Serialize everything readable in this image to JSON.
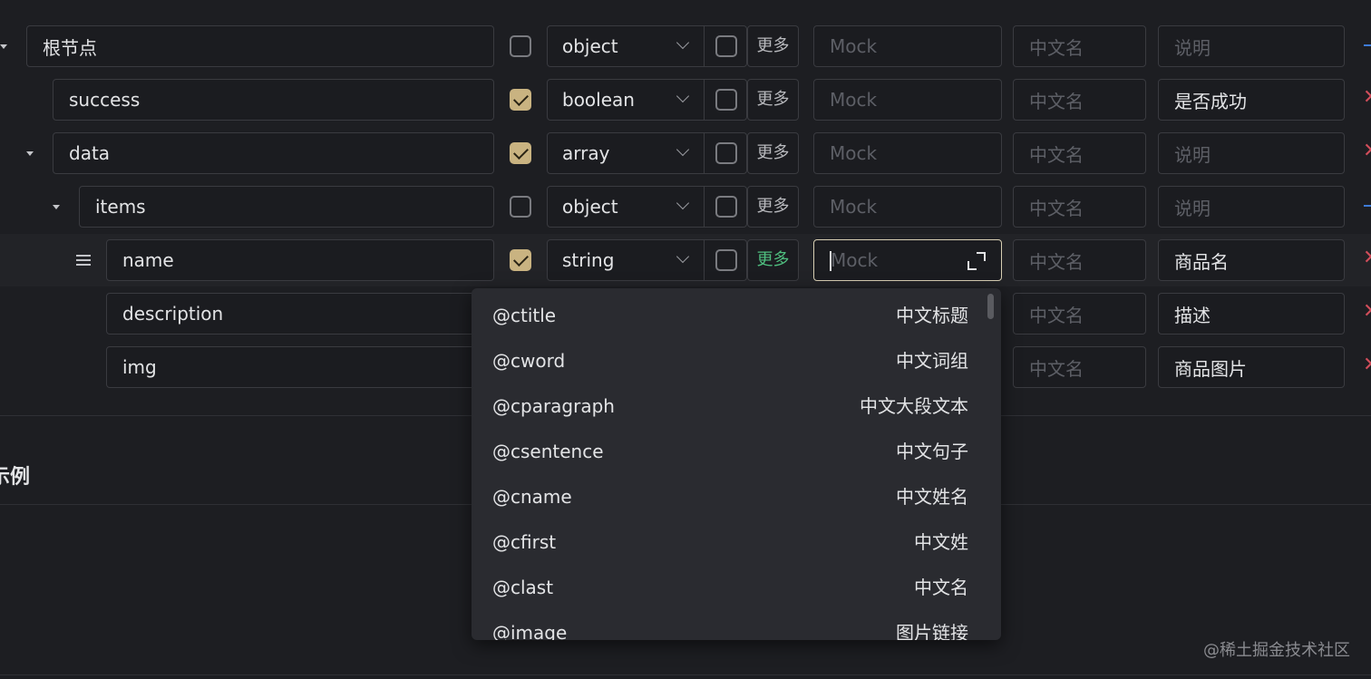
{
  "rows": [
    {
      "name": "根节点",
      "required": false,
      "type": "object",
      "mock_placeholder": "Mock",
      "cn_placeholder": "中文名",
      "desc": "说明",
      "desc_filled": false,
      "more": "更多",
      "action": "add"
    },
    {
      "name": "success",
      "required": true,
      "type": "boolean",
      "mock_placeholder": "Mock",
      "cn_placeholder": "中文名",
      "desc": "是否成功",
      "desc_filled": true,
      "more": "更多",
      "action": "remove"
    },
    {
      "name": "data",
      "required": true,
      "type": "array",
      "mock_placeholder": "Mock",
      "cn_placeholder": "中文名",
      "desc": "说明",
      "desc_filled": false,
      "more": "更多",
      "action": "remove"
    },
    {
      "name": "items",
      "required": false,
      "type": "object",
      "mock_placeholder": "Mock",
      "cn_placeholder": "中文名",
      "desc": "说明",
      "desc_filled": false,
      "more": "更多",
      "action": "add"
    },
    {
      "name": "name",
      "required": true,
      "type": "string",
      "mock_placeholder": "Mock",
      "cn_placeholder": "中文名",
      "desc": "商品名",
      "desc_filled": true,
      "more": "更多",
      "action": "remove"
    },
    {
      "name": "description",
      "cn_placeholder": "中文名",
      "desc": "描述",
      "desc_filled": true,
      "action": "remove"
    },
    {
      "name": "img",
      "cn_placeholder": "中文名",
      "desc": "商品图片",
      "desc_filled": true,
      "action": "remove"
    }
  ],
  "section_title": "示例",
  "mock_options": [
    {
      "key": "@ctitle",
      "label": "中文标题"
    },
    {
      "key": "@cword",
      "label": "中文词组"
    },
    {
      "key": "@cparagraph",
      "label": "中文大段文本"
    },
    {
      "key": "@csentence",
      "label": "中文句子"
    },
    {
      "key": "@cname",
      "label": "中文姓名"
    },
    {
      "key": "@cfirst",
      "label": "中文姓"
    },
    {
      "key": "@clast",
      "label": "中文名"
    },
    {
      "key": "@image",
      "label": "图片链接"
    }
  ],
  "watermark": "@稀土掘金技术社区",
  "colors": {
    "background": "#1d1e22",
    "checked": "#c9b381",
    "focus_border": "#d8cfb4",
    "more_active": "#4fbf7f",
    "remove": "#d14d5a",
    "add": "#3d7bd8"
  }
}
